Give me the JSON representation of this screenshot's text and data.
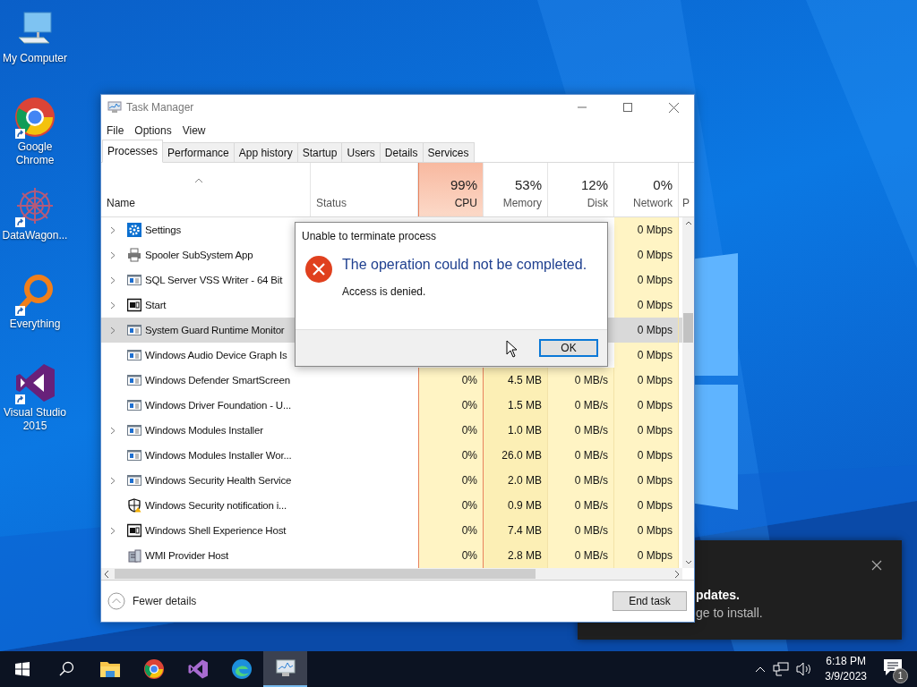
{
  "desktop_icons": [
    {
      "label": "My Computer",
      "kind": "computer",
      "shortcut": false
    },
    {
      "label": "Google Chrome",
      "kind": "chrome",
      "shortcut": true
    },
    {
      "label": "DataWagon...",
      "kind": "datawagon",
      "shortcut": true
    },
    {
      "label": "Everything",
      "kind": "everything",
      "shortcut": true
    },
    {
      "label": "Visual Studio 2015",
      "kind": "vs",
      "shortcut": true
    }
  ],
  "task_manager": {
    "title": "Task Manager",
    "menu": [
      "File",
      "Options",
      "View"
    ],
    "tabs": [
      {
        "label": "Processes",
        "selected": true
      },
      {
        "label": "Performance",
        "selected": false
      },
      {
        "label": "App history",
        "selected": false
      },
      {
        "label": "Startup",
        "selected": false
      },
      {
        "label": "Users",
        "selected": false
      },
      {
        "label": "Details",
        "selected": false
      },
      {
        "label": "Services",
        "selected": false
      }
    ],
    "columns": {
      "name": "Name",
      "status": "Status",
      "metrics": [
        {
          "value": "99%",
          "label": "CPU",
          "highlight": true
        },
        {
          "value": "53%",
          "label": "Memory",
          "highlight": false
        },
        {
          "value": "12%",
          "label": "Disk",
          "highlight": false
        },
        {
          "value": "0%",
          "label": "Network",
          "highlight": false
        }
      ],
      "column_7": "P"
    },
    "rows": [
      {
        "name": "Settings",
        "kind": "gear",
        "expandable": true,
        "selected": false,
        "network": "0 Mbps"
      },
      {
        "name": "Spooler SubSystem App",
        "kind": "printer",
        "expandable": true,
        "selected": false,
        "network": "0 Mbps"
      },
      {
        "name": "SQL Server VSS Writer - 64 Bit",
        "kind": "service",
        "expandable": true,
        "selected": false,
        "network": "0 Mbps"
      },
      {
        "name": "Start",
        "kind": "frame",
        "expandable": true,
        "selected": false,
        "network": "0 Mbps"
      },
      {
        "name": "System Guard Runtime Monitor",
        "kind": "service",
        "expandable": true,
        "selected": true,
        "network": "0 Mbps"
      },
      {
        "name": "Windows Audio Device Graph Is",
        "kind": "service",
        "expandable": false,
        "selected": false,
        "network": "0 Mbps"
      },
      {
        "name": "Windows Defender SmartScreen",
        "kind": "service",
        "expandable": false,
        "selected": false,
        "cpu": "0%",
        "memory": "4.5 MB",
        "disk": "0 MB/s",
        "network": "0 Mbps"
      },
      {
        "name": "Windows Driver Foundation - U...",
        "kind": "service",
        "expandable": false,
        "selected": false,
        "cpu": "0%",
        "memory": "1.5 MB",
        "disk": "0 MB/s",
        "network": "0 Mbps"
      },
      {
        "name": "Windows Modules Installer",
        "kind": "service",
        "expandable": true,
        "selected": false,
        "cpu": "0%",
        "memory": "1.0 MB",
        "disk": "0 MB/s",
        "network": "0 Mbps"
      },
      {
        "name": "Windows Modules Installer Wor...",
        "kind": "service",
        "expandable": false,
        "selected": false,
        "cpu": "0%",
        "memory": "26.0 MB",
        "disk": "0 MB/s",
        "network": "0 Mbps"
      },
      {
        "name": "Windows Security Health Service",
        "kind": "service",
        "expandable": true,
        "selected": false,
        "cpu": "0%",
        "memory": "2.0 MB",
        "disk": "0 MB/s",
        "network": "0 Mbps"
      },
      {
        "name": "Windows Security notification i...",
        "kind": "shield",
        "expandable": false,
        "selected": false,
        "cpu": "0%",
        "memory": "0.9 MB",
        "disk": "0 MB/s",
        "network": "0 Mbps"
      },
      {
        "name": "Windows Shell Experience Host",
        "kind": "frame",
        "expandable": true,
        "selected": false,
        "cpu": "0%",
        "memory": "7.4 MB",
        "disk": "0 MB/s",
        "network": "0 Mbps"
      },
      {
        "name": "WMI Provider Host",
        "kind": "wmi",
        "expandable": false,
        "selected": false,
        "cpu": "0%",
        "memory": "2.8 MB",
        "disk": "0 MB/s",
        "network": "0 Mbps"
      }
    ],
    "footer": {
      "toggle": "Fewer details",
      "button": "End task"
    }
  },
  "dialog": {
    "title": "Unable to terminate process",
    "heading": "The operation could not be completed.",
    "message": "Access is denied.",
    "button": "OK"
  },
  "toast": {
    "title": "pdates.",
    "body": "ge to install."
  },
  "taskbar": {
    "items": [
      {
        "kind": "start",
        "selected": false
      },
      {
        "kind": "search",
        "selected": false
      },
      {
        "kind": "explorer",
        "selected": false
      },
      {
        "kind": "chrome",
        "selected": false
      },
      {
        "kind": "vs",
        "selected": false
      },
      {
        "kind": "edge",
        "selected": false
      },
      {
        "kind": "taskmanager",
        "selected": true
      }
    ],
    "time": "6:18 PM",
    "date": "3/9/2023",
    "notifications": "1"
  }
}
